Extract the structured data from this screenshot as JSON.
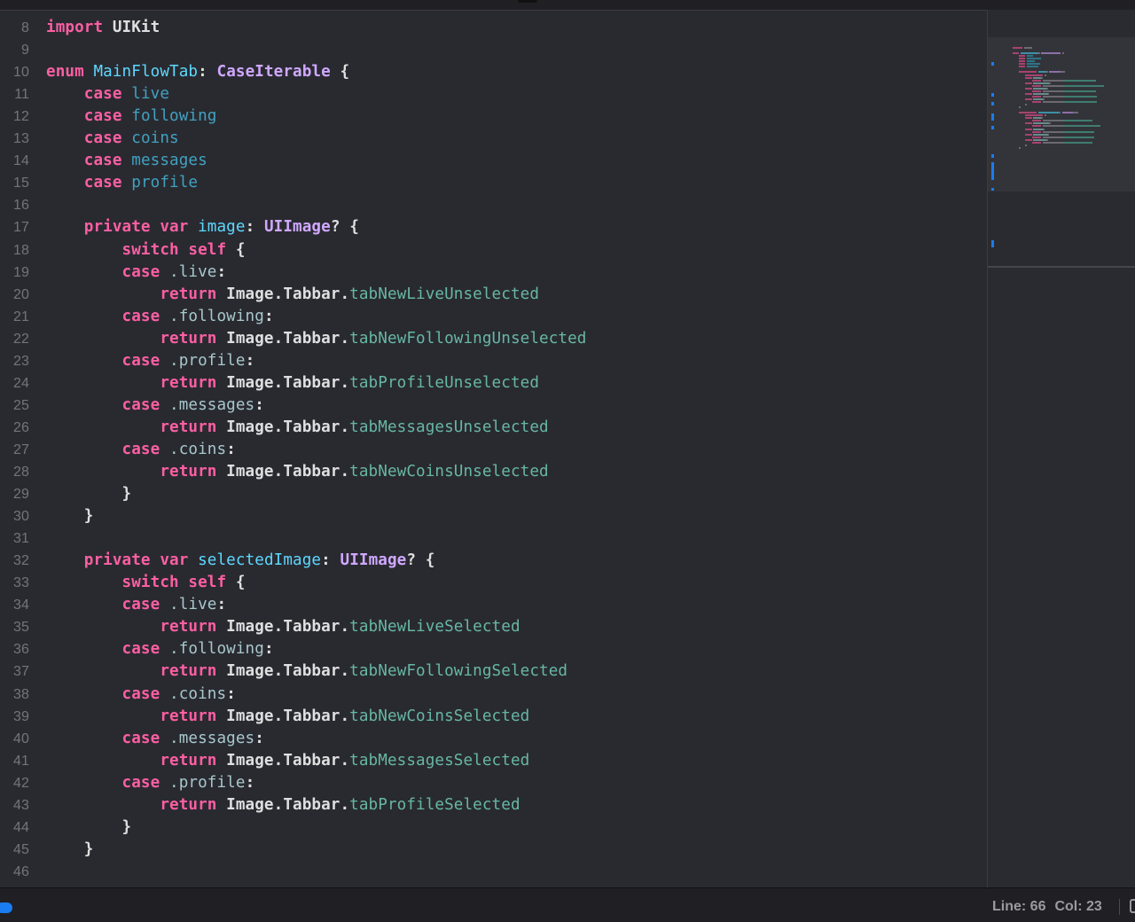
{
  "status": {
    "line_label": "Line: 66",
    "col_label": "Col: 23"
  },
  "colors": {
    "keyword": "#fc5fa3",
    "type": "#d0a8ff",
    "declaration": "#5dd8ff",
    "property": "#67b7a4",
    "background": "#292a30",
    "accent": "#1a7cf0"
  },
  "code_lines": [
    {
      "n": "8",
      "t": [
        [
          "kw",
          "import"
        ],
        [
          "plain",
          " UIKit"
        ]
      ]
    },
    {
      "n": "9",
      "t": []
    },
    {
      "n": "10",
      "t": [
        [
          "kw",
          "enum"
        ],
        [
          "plain",
          " "
        ],
        [
          "decl",
          "MainFlowTab"
        ],
        [
          "plain",
          ": "
        ],
        [
          "type",
          "CaseIterable"
        ],
        [
          "plain",
          " {"
        ]
      ]
    },
    {
      "n": "11",
      "t": [
        [
          "plain",
          "    "
        ],
        [
          "kw",
          "case"
        ],
        [
          "plain",
          " "
        ],
        [
          "case",
          "live"
        ]
      ]
    },
    {
      "n": "12",
      "t": [
        [
          "plain",
          "    "
        ],
        [
          "kw",
          "case"
        ],
        [
          "plain",
          " "
        ],
        [
          "case",
          "following"
        ]
      ]
    },
    {
      "n": "13",
      "t": [
        [
          "plain",
          "    "
        ],
        [
          "kw",
          "case"
        ],
        [
          "plain",
          " "
        ],
        [
          "case",
          "coins"
        ]
      ]
    },
    {
      "n": "14",
      "t": [
        [
          "plain",
          "    "
        ],
        [
          "kw",
          "case"
        ],
        [
          "plain",
          " "
        ],
        [
          "case",
          "messages"
        ]
      ]
    },
    {
      "n": "15",
      "t": [
        [
          "plain",
          "    "
        ],
        [
          "kw",
          "case"
        ],
        [
          "plain",
          " "
        ],
        [
          "case",
          "profile"
        ]
      ]
    },
    {
      "n": "16",
      "t": []
    },
    {
      "n": "17",
      "t": [
        [
          "plain",
          "    "
        ],
        [
          "kw",
          "private var"
        ],
        [
          "plain",
          " "
        ],
        [
          "decl",
          "image"
        ],
        [
          "plain",
          ": "
        ],
        [
          "type",
          "UIImage"
        ],
        [
          "plain",
          "? {"
        ]
      ]
    },
    {
      "n": "18",
      "t": [
        [
          "plain",
          "        "
        ],
        [
          "kw",
          "switch self"
        ],
        [
          "plain",
          " {"
        ]
      ]
    },
    {
      "n": "19",
      "t": [
        [
          "plain",
          "        "
        ],
        [
          "kw",
          "case"
        ],
        [
          "mem",
          " .live"
        ],
        [
          "plain",
          ":"
        ]
      ]
    },
    {
      "n": "20",
      "t": [
        [
          "plain",
          "            "
        ],
        [
          "kw",
          "return"
        ],
        [
          "plain",
          " Image.Tabbar."
        ],
        [
          "prop",
          "tabNewLiveUnselected"
        ]
      ]
    },
    {
      "n": "21",
      "t": [
        [
          "plain",
          "        "
        ],
        [
          "kw",
          "case"
        ],
        [
          "mem",
          " .following"
        ],
        [
          "plain",
          ":"
        ]
      ]
    },
    {
      "n": "22",
      "t": [
        [
          "plain",
          "            "
        ],
        [
          "kw",
          "return"
        ],
        [
          "plain",
          " Image.Tabbar."
        ],
        [
          "prop",
          "tabNewFollowingUnselected"
        ]
      ]
    },
    {
      "n": "23",
      "t": [
        [
          "plain",
          "        "
        ],
        [
          "kw",
          "case"
        ],
        [
          "mem",
          " .profile"
        ],
        [
          "plain",
          ":"
        ]
      ]
    },
    {
      "n": "24",
      "t": [
        [
          "plain",
          "            "
        ],
        [
          "kw",
          "return"
        ],
        [
          "plain",
          " Image.Tabbar."
        ],
        [
          "prop",
          "tabProfileUnselected"
        ]
      ]
    },
    {
      "n": "25",
      "t": [
        [
          "plain",
          "        "
        ],
        [
          "kw",
          "case"
        ],
        [
          "mem",
          " .messages"
        ],
        [
          "plain",
          ":"
        ]
      ]
    },
    {
      "n": "26",
      "t": [
        [
          "plain",
          "            "
        ],
        [
          "kw",
          "return"
        ],
        [
          "plain",
          " Image.Tabbar."
        ],
        [
          "prop",
          "tabMessagesUnselected"
        ]
      ]
    },
    {
      "n": "27",
      "t": [
        [
          "plain",
          "        "
        ],
        [
          "kw",
          "case"
        ],
        [
          "mem",
          " .coins"
        ],
        [
          "plain",
          ":"
        ]
      ]
    },
    {
      "n": "28",
      "t": [
        [
          "plain",
          "            "
        ],
        [
          "kw",
          "return"
        ],
        [
          "plain",
          " Image.Tabbar."
        ],
        [
          "prop",
          "tabNewCoinsUnselected"
        ]
      ]
    },
    {
      "n": "29",
      "t": [
        [
          "plain",
          "        }"
        ]
      ]
    },
    {
      "n": "30",
      "t": [
        [
          "plain",
          "    }"
        ]
      ]
    },
    {
      "n": "31",
      "t": []
    },
    {
      "n": "32",
      "t": [
        [
          "plain",
          "    "
        ],
        [
          "kw",
          "private var"
        ],
        [
          "plain",
          " "
        ],
        [
          "decl",
          "selectedImage"
        ],
        [
          "plain",
          ": "
        ],
        [
          "type",
          "UIImage"
        ],
        [
          "plain",
          "? {"
        ]
      ]
    },
    {
      "n": "33",
      "t": [
        [
          "plain",
          "        "
        ],
        [
          "kw",
          "switch self"
        ],
        [
          "plain",
          " {"
        ]
      ]
    },
    {
      "n": "34",
      "t": [
        [
          "plain",
          "        "
        ],
        [
          "kw",
          "case"
        ],
        [
          "mem",
          " .live"
        ],
        [
          "plain",
          ":"
        ]
      ]
    },
    {
      "n": "35",
      "t": [
        [
          "plain",
          "            "
        ],
        [
          "kw",
          "return"
        ],
        [
          "plain",
          " Image.Tabbar."
        ],
        [
          "prop",
          "tabNewLiveSelected"
        ]
      ]
    },
    {
      "n": "36",
      "t": [
        [
          "plain",
          "        "
        ],
        [
          "kw",
          "case"
        ],
        [
          "mem",
          " .following"
        ],
        [
          "plain",
          ":"
        ]
      ]
    },
    {
      "n": "37",
      "t": [
        [
          "plain",
          "            "
        ],
        [
          "kw",
          "return"
        ],
        [
          "plain",
          " Image.Tabbar."
        ],
        [
          "prop",
          "tabNewFollowingSelected"
        ]
      ]
    },
    {
      "n": "38",
      "t": [
        [
          "plain",
          "        "
        ],
        [
          "kw",
          "case"
        ],
        [
          "mem",
          " .coins"
        ],
        [
          "plain",
          ":"
        ]
      ]
    },
    {
      "n": "39",
      "t": [
        [
          "plain",
          "            "
        ],
        [
          "kw",
          "return"
        ],
        [
          "plain",
          " Image.Tabbar."
        ],
        [
          "prop",
          "tabNewCoinsSelected"
        ]
      ]
    },
    {
      "n": "40",
      "t": [
        [
          "plain",
          "        "
        ],
        [
          "kw",
          "case"
        ],
        [
          "mem",
          " .messages"
        ],
        [
          "plain",
          ":"
        ]
      ]
    },
    {
      "n": "41",
      "t": [
        [
          "plain",
          "            "
        ],
        [
          "kw",
          "return"
        ],
        [
          "plain",
          " Image.Tabbar."
        ],
        [
          "prop",
          "tabMessagesSelected"
        ]
      ]
    },
    {
      "n": "42",
      "t": [
        [
          "plain",
          "        "
        ],
        [
          "kw",
          "case"
        ],
        [
          "mem",
          " .profile"
        ],
        [
          "plain",
          ":"
        ]
      ]
    },
    {
      "n": "43",
      "t": [
        [
          "plain",
          "            "
        ],
        [
          "kw",
          "return"
        ],
        [
          "plain",
          " Image.Tabbar."
        ],
        [
          "prop",
          "tabProfileSelected"
        ]
      ]
    },
    {
      "n": "44",
      "t": [
        [
          "plain",
          "        }"
        ]
      ]
    },
    {
      "n": "45",
      "t": [
        [
          "plain",
          "    }"
        ]
      ]
    },
    {
      "n": "46",
      "t": []
    }
  ]
}
